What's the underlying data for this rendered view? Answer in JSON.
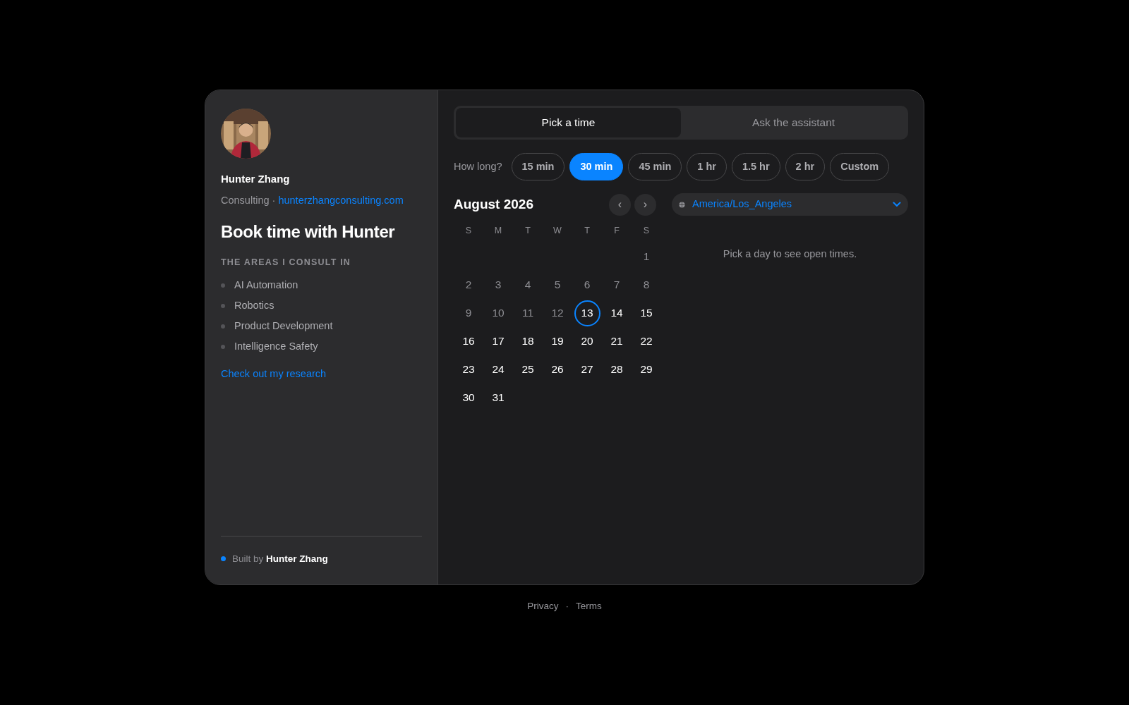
{
  "profile": {
    "name": "Hunter Zhang",
    "company": "Consulting",
    "separator": "·",
    "website": "hunterzhangconsulting.com"
  },
  "heading": "Book time with Hunter",
  "areas": {
    "title": "THE AREAS I CONSULT IN",
    "items": [
      "AI Automation",
      "Robotics",
      "Product Development",
      "Intelligence Safety"
    ]
  },
  "research_link": "Check out my research",
  "built_by": {
    "prefix": "Built by",
    "name": "Hunter Zhang",
    "color": "#0a84ff"
  },
  "tabs": [
    {
      "label": "Pick a time",
      "selected": true
    },
    {
      "label": "Ask the assistant",
      "selected": false
    }
  ],
  "duration": {
    "label": "How long?",
    "options": [
      {
        "label": "15 min",
        "selected": false
      },
      {
        "label": "30 min",
        "selected": true
      },
      {
        "label": "45 min",
        "selected": false
      },
      {
        "label": "1 hr",
        "selected": false
      },
      {
        "label": "1.5 hr",
        "selected": false
      },
      {
        "label": "2 hr",
        "selected": false
      },
      {
        "label": "Custom",
        "selected": false
      }
    ]
  },
  "calendar": {
    "month": "August 2026",
    "prev": "‹",
    "next": "›",
    "weekdays": [
      "S",
      "M",
      "T",
      "W",
      "T",
      "F",
      "S"
    ],
    "weeks": [
      [
        {
          "day": "1",
          "disabled": true,
          "today": false
        }
      ],
      [
        {
          "day": "2",
          "disabled": true,
          "today": false
        },
        {
          "day": "3",
          "disabled": true,
          "today": false
        },
        {
          "day": "4",
          "disabled": true,
          "today": false
        },
        {
          "day": "5",
          "disabled": true,
          "today": false
        },
        {
          "day": "6",
          "disabled": true,
          "today": false
        },
        {
          "day": "7",
          "disabled": true,
          "today": false
        },
        {
          "day": "8",
          "disabled": true,
          "today": false
        }
      ],
      [
        {
          "day": "9",
          "disabled": true,
          "today": false
        },
        {
          "day": "10",
          "disabled": true,
          "today": false
        },
        {
          "day": "11",
          "disabled": true,
          "today": false
        },
        {
          "day": "12",
          "disabled": true,
          "today": false
        },
        {
          "day": "13",
          "disabled": false,
          "today": true
        },
        {
          "day": "14",
          "disabled": false,
          "today": false
        },
        {
          "day": "15",
          "disabled": false,
          "today": false
        }
      ],
      [
        {
          "day": "16",
          "disabled": false,
          "today": false
        },
        {
          "day": "17",
          "disabled": false,
          "today": false
        },
        {
          "day": "18",
          "disabled": false,
          "today": false
        },
        {
          "day": "19",
          "disabled": false,
          "today": false
        },
        {
          "day": "20",
          "disabled": false,
          "today": false
        },
        {
          "day": "21",
          "disabled": false,
          "today": false
        },
        {
          "day": "22",
          "disabled": false,
          "today": false
        }
      ],
      [
        {
          "day": "23",
          "disabled": false,
          "today": false
        },
        {
          "day": "24",
          "disabled": false,
          "today": false
        },
        {
          "day": "25",
          "disabled": false,
          "today": false
        },
        {
          "day": "26",
          "disabled": false,
          "today": false
        },
        {
          "day": "27",
          "disabled": false,
          "today": false
        },
        {
          "day": "28",
          "disabled": false,
          "today": false
        },
        {
          "day": "29",
          "disabled": false,
          "today": false
        }
      ],
      [
        {
          "day": "30",
          "disabled": false,
          "today": false
        },
        {
          "day": "31",
          "disabled": false,
          "today": false
        }
      ]
    ]
  },
  "timezone": {
    "value": "America/Los_Angeles"
  },
  "times_hint": "Pick a day to see open times.",
  "footer": {
    "links": [
      "Privacy",
      "Terms"
    ],
    "separator": "·"
  }
}
